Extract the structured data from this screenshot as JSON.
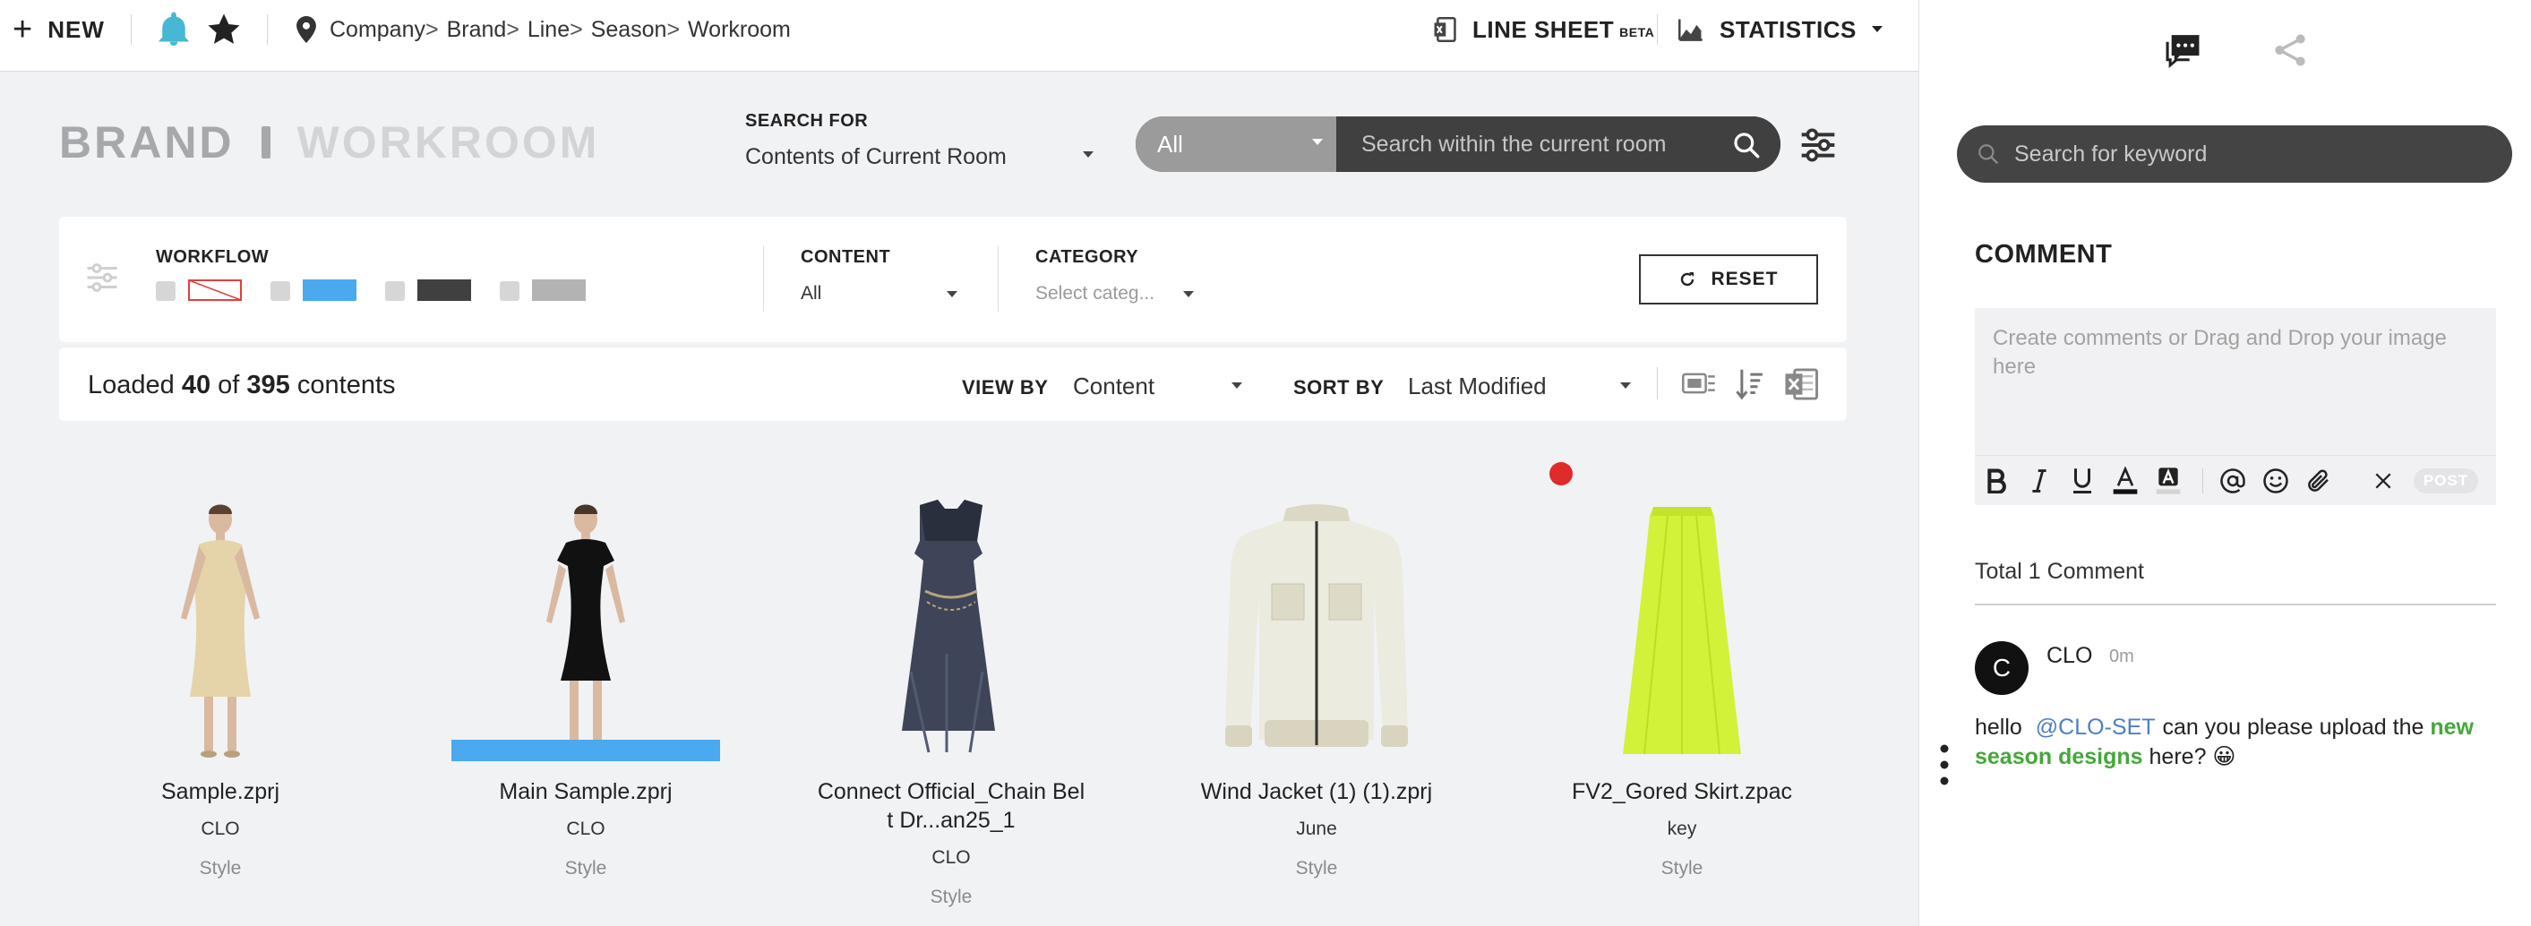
{
  "topbar": {
    "new_label": "NEW",
    "breadcrumb": [
      "Company",
      "Brand",
      "Line",
      "Season",
      "Workroom"
    ],
    "breadcrumb_sep": ">",
    "linesheet_label": "LINE SHEET",
    "linesheet_badge": "BETA",
    "statistics_label": "STATISTICS"
  },
  "page_title": {
    "brand": "BRAND",
    "room": "WORKROOM"
  },
  "search": {
    "for_label": "SEARCH FOR",
    "for_value": "Contents of Current Room",
    "scope": "All",
    "placeholder": "Search within the current room"
  },
  "filters": {
    "workflow_label": "WORKFLOW",
    "workflow_swatches": [
      "none",
      "#4aa9ef",
      "#404040",
      "#b3b3b3"
    ],
    "content_label": "CONTENT",
    "content_value": "All",
    "category_label": "CATEGORY",
    "category_placeholder": "Select categ...",
    "reset_label": "RESET"
  },
  "view_bar": {
    "loaded_prefix": "Loaded",
    "loaded_count": "40",
    "loaded_of": "of",
    "total_count": "395",
    "loaded_suffix": "contents",
    "view_by_label": "VIEW BY",
    "view_by_value": "Content",
    "sort_by_label": "SORT BY",
    "sort_by_value": "Last Modified"
  },
  "cards": [
    {
      "name": "Sample.zprj",
      "owner": "CLO",
      "type": "Style"
    },
    {
      "name": "Main Sample.zprj",
      "owner": "CLO",
      "type": "Style"
    },
    {
      "name": "Connect Official_Chain Bel t Dr...an25_1",
      "owner": "CLO",
      "type": "Style"
    },
    {
      "name": "Wind Jacket (1) (1).zprj",
      "owner": "June",
      "type": "Style"
    },
    {
      "name": "FV2_Gored Skirt.zpac",
      "owner": "key",
      "type": "Style"
    }
  ],
  "side": {
    "search_placeholder": "Search for keyword",
    "comment_heading": "COMMENT",
    "editor_placeholder": "Create comments or Drag and Drop your image here",
    "post_label": "POST",
    "total_label": "Total 1 Comment",
    "comment": {
      "avatar_letter": "C",
      "author": "CLO",
      "time": "0m",
      "text_before": "hello",
      "mention": "@CLO-SET",
      "text_middle": "can you please upload the",
      "tag": "new season designs",
      "text_after": "here? 😀"
    }
  },
  "colors": {
    "accent_blue": "#4aa9ef",
    "bell": "#48b7d3",
    "mention": "#4b7fc4",
    "tag_green": "#43a83a",
    "alert_red": "#e02b2b"
  }
}
